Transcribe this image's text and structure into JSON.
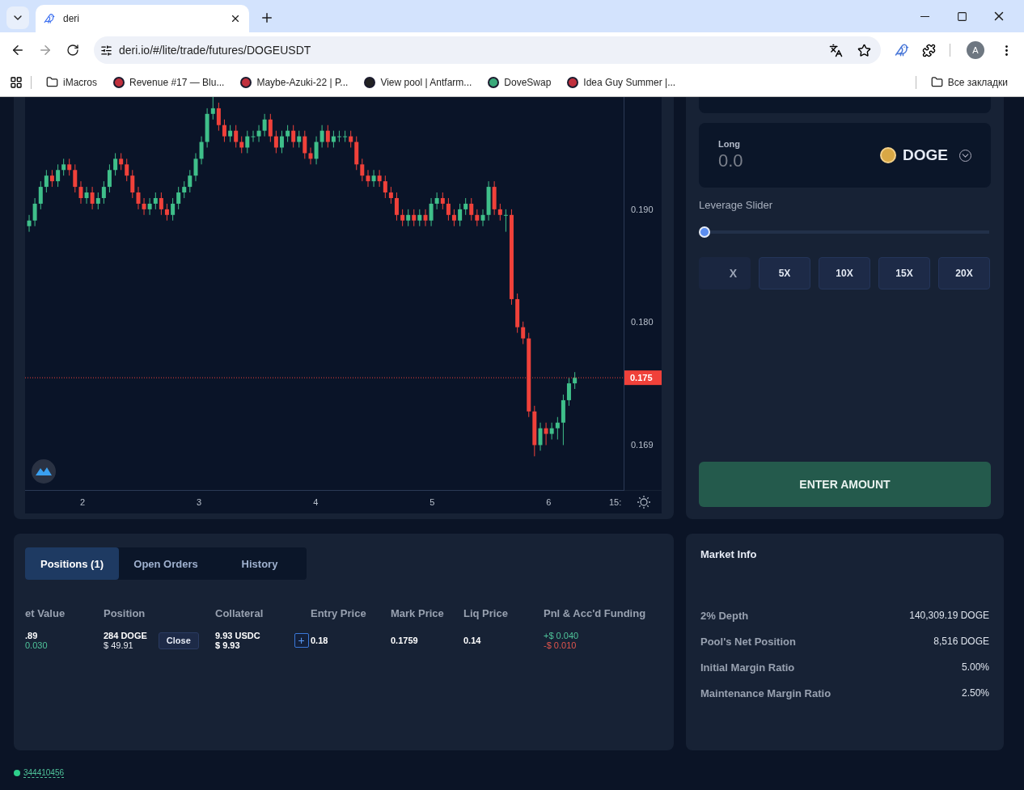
{
  "browser": {
    "tab_title": "deri",
    "url": "deri.io/#/lite/trade/futures/DOGEUSDT",
    "bookmarks": [
      {
        "label": "iMacros",
        "kind": "folder"
      },
      {
        "label": "Revenue #17 — Blu...",
        "kind": "site"
      },
      {
        "label": "Maybe-Azuki-22 | P...",
        "kind": "site"
      },
      {
        "label": "View pool | Antfarm...",
        "kind": "pool"
      },
      {
        "label": "DoveSwap",
        "kind": "swap"
      },
      {
        "label": "Idea Guy Summer |...",
        "kind": "site"
      }
    ],
    "all_bookmarks": "Все закладки",
    "profile_initial": "A"
  },
  "chart": {
    "cut_time_label": "15:",
    "chart_data": {
      "type": "candlestick",
      "xlim": [
        1.506,
        6.644
      ],
      "ylim": [
        0.165,
        0.2
      ],
      "yticks": [
        {
          "value": 0.19,
          "label": "0.190"
        },
        {
          "value": 0.18,
          "label": "0.180"
        },
        {
          "value": 0.169,
          "label": "0.169"
        }
      ],
      "xticks": [
        2,
        3,
        4,
        5,
        6
      ],
      "ref_lines": [
        {
          "axis": "y",
          "value": 0.175,
          "label": "0.175",
          "color": "#f0413a"
        }
      ],
      "x": [
        1.541,
        1.59,
        1.64,
        1.689,
        1.738,
        1.788,
        1.837,
        1.886,
        1.935,
        1.985,
        2.034,
        2.083,
        2.133,
        2.182,
        2.231,
        2.281,
        2.33,
        2.379,
        2.428,
        2.478,
        2.527,
        2.576,
        2.626,
        2.675,
        2.724,
        2.774,
        2.823,
        2.872,
        2.921,
        2.971,
        3.02,
        3.069,
        3.119,
        3.168,
        3.217,
        3.267,
        3.316,
        3.365,
        3.414,
        3.464,
        3.513,
        3.562,
        3.612,
        3.661,
        3.71,
        3.76,
        3.809,
        3.858,
        3.907,
        3.957,
        4.006,
        4.055,
        4.105,
        4.154,
        4.203,
        4.253,
        4.302,
        4.351,
        4.4,
        4.45,
        4.499,
        4.548,
        4.598,
        4.647,
        4.696,
        4.746,
        4.795,
        4.844,
        4.893,
        4.943,
        4.992,
        5.041,
        5.091,
        5.14,
        5.189,
        5.239,
        5.288,
        5.337,
        5.386,
        5.436,
        5.485,
        5.534,
        5.584,
        5.633,
        5.682,
        5.732,
        5.781,
        5.83,
        5.879,
        5.929,
        5.978,
        6.027,
        6.077,
        6.126,
        6.175,
        6.225
      ],
      "ohlc": [
        [
          0.1885,
          0.1895,
          0.188,
          0.189
        ],
        [
          0.189,
          0.191,
          0.1885,
          0.1905
        ],
        [
          0.1905,
          0.1925,
          0.19,
          0.192
        ],
        [
          0.192,
          0.1935,
          0.1915,
          0.193
        ],
        [
          0.193,
          0.1935,
          0.192,
          0.1925
        ],
        [
          0.1925,
          0.194,
          0.192,
          0.1935
        ],
        [
          0.1935,
          0.1945,
          0.193,
          0.194
        ],
        [
          0.194,
          0.1945,
          0.193,
          0.1935
        ],
        [
          0.1935,
          0.194,
          0.1915,
          0.192
        ],
        [
          0.192,
          0.1925,
          0.1905,
          0.191
        ],
        [
          0.191,
          0.192,
          0.1905,
          0.1915
        ],
        [
          0.1915,
          0.192,
          0.19,
          0.1905
        ],
        [
          0.1905,
          0.1915,
          0.19,
          0.191
        ],
        [
          0.191,
          0.1925,
          0.1905,
          0.192
        ],
        [
          0.192,
          0.194,
          0.1915,
          0.1935
        ],
        [
          0.1935,
          0.195,
          0.193,
          0.1945
        ],
        [
          0.1945,
          0.195,
          0.1935,
          0.194
        ],
        [
          0.194,
          0.1945,
          0.1925,
          0.193
        ],
        [
          0.193,
          0.1935,
          0.191,
          0.1915
        ],
        [
          0.1915,
          0.192,
          0.19,
          0.1905
        ],
        [
          0.1905,
          0.191,
          0.1895,
          0.19
        ],
        [
          0.19,
          0.191,
          0.1895,
          0.1905
        ],
        [
          0.1905,
          0.1915,
          0.19,
          0.191
        ],
        [
          0.191,
          0.1915,
          0.1895,
          0.19
        ],
        [
          0.19,
          0.1905,
          0.189,
          0.1895
        ],
        [
          0.1895,
          0.191,
          0.189,
          0.1905
        ],
        [
          0.1905,
          0.192,
          0.19,
          0.1915
        ],
        [
          0.1915,
          0.1925,
          0.191,
          0.192
        ],
        [
          0.192,
          0.1935,
          0.1915,
          0.193
        ],
        [
          0.193,
          0.195,
          0.1925,
          0.1945
        ],
        [
          0.1945,
          0.1965,
          0.194,
          0.196
        ],
        [
          0.196,
          0.199,
          0.1955,
          0.1985
        ],
        [
          0.1985,
          0.2,
          0.198,
          0.199
        ],
        [
          0.199,
          0.1995,
          0.197,
          0.1975
        ],
        [
          0.1975,
          0.198,
          0.196,
          0.1965
        ],
        [
          0.1965,
          0.1975,
          0.196,
          0.197
        ],
        [
          0.197,
          0.1975,
          0.1955,
          0.196
        ],
        [
          0.196,
          0.1965,
          0.195,
          0.1955
        ],
        [
          0.1955,
          0.197,
          0.195,
          0.1965
        ],
        [
          0.1965,
          0.197,
          0.196,
          0.1965
        ],
        [
          0.1965,
          0.1975,
          0.196,
          0.197
        ],
        [
          0.197,
          0.1985,
          0.1965,
          0.198
        ],
        [
          0.198,
          0.1985,
          0.196,
          0.1965
        ],
        [
          0.1965,
          0.197,
          0.195,
          0.1955
        ],
        [
          0.1955,
          0.197,
          0.195,
          0.1965
        ],
        [
          0.1965,
          0.1975,
          0.196,
          0.197
        ],
        [
          0.197,
          0.1975,
          0.1955,
          0.196
        ],
        [
          0.196,
          0.197,
          0.1955,
          0.1965
        ],
        [
          0.1965,
          0.197,
          0.1945,
          0.195
        ],
        [
          0.195,
          0.1955,
          0.194,
          0.1945
        ],
        [
          0.1945,
          0.1965,
          0.194,
          0.196
        ],
        [
          0.196,
          0.1975,
          0.1955,
          0.197
        ],
        [
          0.197,
          0.1975,
          0.1955,
          0.196
        ],
        [
          0.196,
          0.197,
          0.1955,
          0.1965
        ],
        [
          0.1965,
          0.197,
          0.196,
          0.1965
        ],
        [
          0.1965,
          0.197,
          0.196,
          0.1965
        ],
        [
          0.1965,
          0.197,
          0.1955,
          0.196
        ],
        [
          0.196,
          0.1965,
          0.1935,
          0.194
        ],
        [
          0.194,
          0.1945,
          0.1925,
          0.193
        ],
        [
          0.193,
          0.1935,
          0.192,
          0.1925
        ],
        [
          0.1925,
          0.1935,
          0.192,
          0.193
        ],
        [
          0.193,
          0.1935,
          0.192,
          0.1925
        ],
        [
          0.1925,
          0.193,
          0.191,
          0.1915
        ],
        [
          0.1915,
          0.192,
          0.1905,
          0.191
        ],
        [
          0.191,
          0.1915,
          0.189,
          0.1895
        ],
        [
          0.1895,
          0.19,
          0.1885,
          0.189
        ],
        [
          0.189,
          0.19,
          0.1885,
          0.1895
        ],
        [
          0.1895,
          0.19,
          0.1885,
          0.189
        ],
        [
          0.189,
          0.19,
          0.1885,
          0.1895
        ],
        [
          0.1895,
          0.19,
          0.1885,
          0.189
        ],
        [
          0.189,
          0.191,
          0.1885,
          0.1905
        ],
        [
          0.1905,
          0.1915,
          0.19,
          0.191
        ],
        [
          0.191,
          0.1915,
          0.19,
          0.1905
        ],
        [
          0.1905,
          0.191,
          0.189,
          0.1895
        ],
        [
          0.1895,
          0.19,
          0.1885,
          0.189
        ],
        [
          0.189,
          0.1905,
          0.1885,
          0.19
        ],
        [
          0.19,
          0.191,
          0.1895,
          0.1905
        ],
        [
          0.1905,
          0.191,
          0.189,
          0.1895
        ],
        [
          0.1895,
          0.19,
          0.1885,
          0.189
        ],
        [
          0.189,
          0.19,
          0.1885,
          0.1895
        ],
        [
          0.1895,
          0.1925,
          0.189,
          0.192
        ],
        [
          0.192,
          0.1925,
          0.1895,
          0.19
        ],
        [
          0.19,
          0.1905,
          0.189,
          0.1895
        ],
        [
          0.1895,
          0.19,
          0.188,
          0.1895
        ],
        [
          0.1895,
          0.19,
          0.1815,
          0.182
        ],
        [
          0.182,
          0.1825,
          0.179,
          0.1795
        ],
        [
          0.1795,
          0.18,
          0.178,
          0.1785
        ],
        [
          0.1785,
          0.179,
          0.1715,
          0.172
        ],
        [
          0.172,
          0.1725,
          0.168,
          0.169
        ],
        [
          0.169,
          0.171,
          0.1685,
          0.1705
        ],
        [
          0.1705,
          0.171,
          0.169,
          0.17
        ],
        [
          0.17,
          0.171,
          0.1695,
          0.1705
        ],
        [
          0.1705,
          0.1715,
          0.1695,
          0.171
        ],
        [
          0.171,
          0.1735,
          0.169,
          0.173
        ],
        [
          0.173,
          0.175,
          0.1725,
          0.1745
        ],
        [
          0.1745,
          0.1755,
          0.174,
          0.175
        ]
      ]
    }
  },
  "trade": {
    "side_label": "Long",
    "amount_placeholder": "0.0",
    "token": "DOGE",
    "slider_label": "Leverage Slider",
    "leverage": {
      "level": 0
    },
    "leverage_options": [
      {
        "kind": "input",
        "placeholder": "X"
      },
      {
        "kind": "preset",
        "label": "5X"
      },
      {
        "kind": "preset",
        "label": "10X"
      },
      {
        "kind": "preset",
        "label": "15X"
      },
      {
        "kind": "preset",
        "label": "20X"
      }
    ],
    "enter_button": "ENTER AMOUNT"
  },
  "positions": {
    "tabs": [
      {
        "label": "Positions (1)",
        "selected": true
      },
      {
        "label": "Open Orders",
        "selected": false
      },
      {
        "label": "History",
        "selected": false
      }
    ],
    "columns": [
      "et Value",
      "Position",
      "Collateral",
      "Entry Price",
      "Mark Price",
      "Liq Price",
      "Pnl & Acc'd Funding"
    ],
    "rows": [
      {
        "net_value": ".89",
        "net_value_change": "0.030",
        "position": "284 DOGE",
        "position_usd": "$ 49.91",
        "close_button": "Close",
        "collateral": "9.93 USDC",
        "collateral_usd": "$ 9.93",
        "add_button": "+",
        "entry_price": "0.18",
        "mark_price": "0.1759",
        "liq_price": "0.14",
        "pnl": "+$ 0.040",
        "funding": "-$ 0.010"
      }
    ]
  },
  "market_info": {
    "title": "Market Info",
    "rows": [
      {
        "label": "2% Depth",
        "value": "140,309.19 DOGE"
      },
      {
        "label": "Pool's Net Position",
        "value": "8,516 DOGE"
      },
      {
        "label": "Initial Margin Ratio",
        "value": "5.00%"
      },
      {
        "label": "Maintenance Margin Ratio",
        "value": "2.50%"
      }
    ]
  },
  "status": {
    "block": "344410456"
  }
}
